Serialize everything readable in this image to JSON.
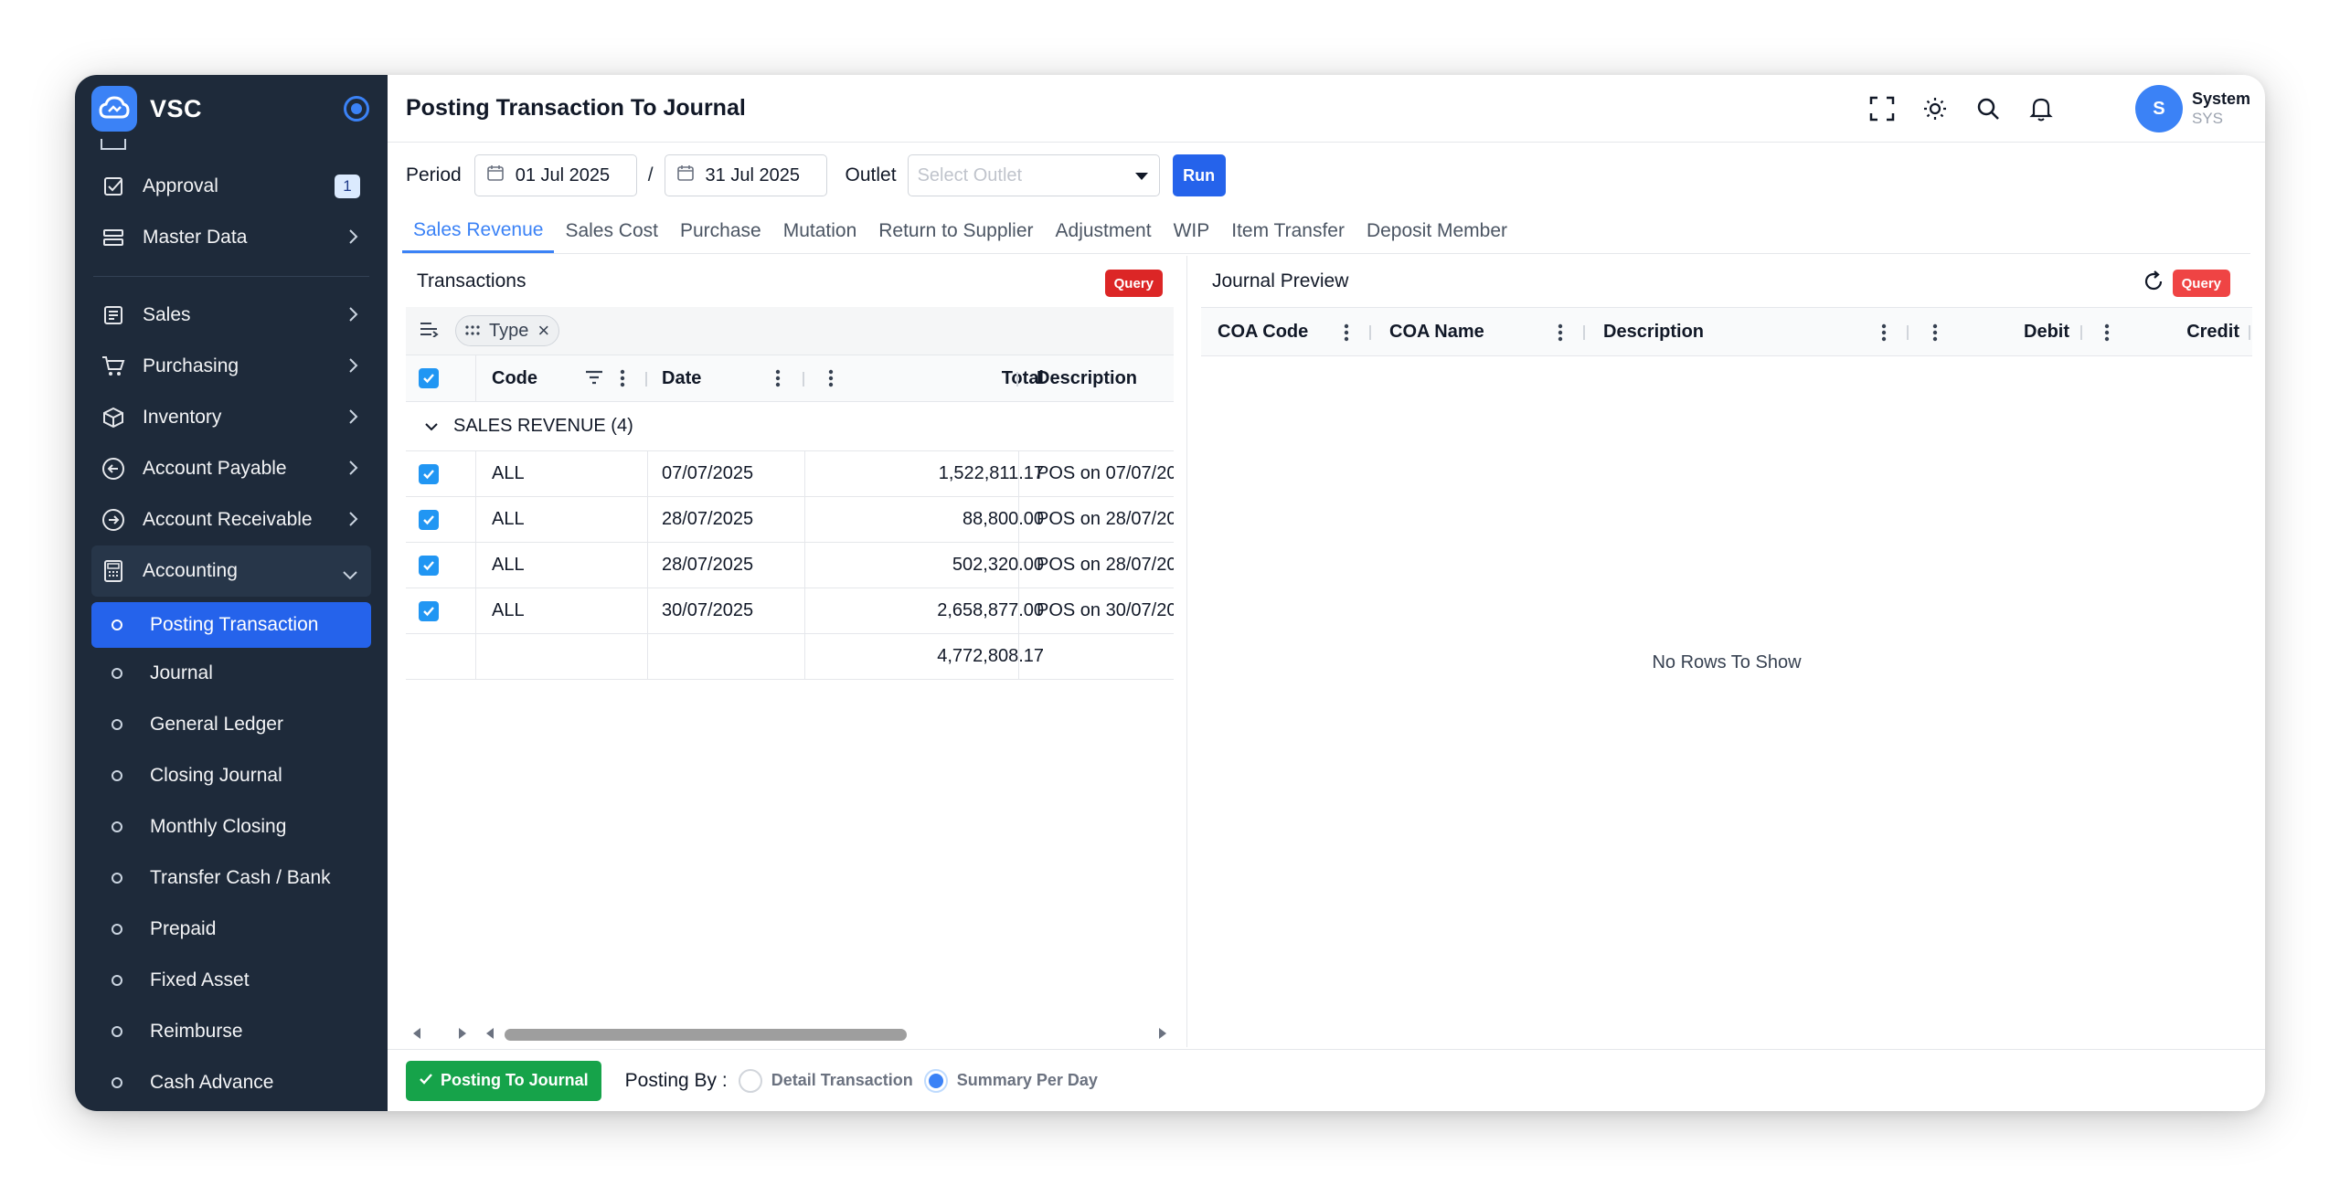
{
  "app": {
    "name": "VSC"
  },
  "sidebar": {
    "items_top": [
      {
        "label": "Approval",
        "badge": "1"
      },
      {
        "label": "Master Data"
      }
    ],
    "items_main": [
      {
        "label": "Sales"
      },
      {
        "label": "Purchasing"
      },
      {
        "label": "Inventory"
      },
      {
        "label": "Account Payable"
      },
      {
        "label": "Account Receivable"
      },
      {
        "label": "Accounting"
      }
    ],
    "submenu": [
      {
        "label": "Posting Transaction"
      },
      {
        "label": "Journal"
      },
      {
        "label": "General Ledger"
      },
      {
        "label": "Closing Journal"
      },
      {
        "label": "Monthly Closing"
      },
      {
        "label": "Transfer Cash / Bank"
      },
      {
        "label": "Prepaid"
      },
      {
        "label": "Fixed Asset"
      },
      {
        "label": "Reimburse"
      },
      {
        "label": "Cash Advance"
      }
    ]
  },
  "header": {
    "title": "Posting Transaction To Journal",
    "user": {
      "initial": "S",
      "name": "System",
      "role": "SYS"
    }
  },
  "filters": {
    "period_label": "Period",
    "date_from": "01 Jul 2025",
    "separator": "/",
    "date_to": "31 Jul 2025",
    "outlet_label": "Outlet",
    "outlet_placeholder": "Select Outlet",
    "run_label": "Run"
  },
  "tabs": [
    {
      "label": "Sales Revenue",
      "active": true
    },
    {
      "label": "Sales Cost"
    },
    {
      "label": "Purchase"
    },
    {
      "label": "Mutation"
    },
    {
      "label": "Return to Supplier"
    },
    {
      "label": "Adjustment"
    },
    {
      "label": "WIP"
    },
    {
      "label": "Item Transfer"
    },
    {
      "label": "Deposit Member"
    }
  ],
  "transactions": {
    "title": "Transactions",
    "query_label": "Query",
    "group_chip": "Type",
    "columns": {
      "code": "Code",
      "date": "Date",
      "total": "Total",
      "description": "Description"
    },
    "group_label": "SALES REVENUE (4)",
    "rows": [
      {
        "code": "ALL",
        "date": "07/07/2025",
        "total": "1,522,811.17",
        "description": "POS on 07/07/20"
      },
      {
        "code": "ALL",
        "date": "28/07/2025",
        "total": "88,800.00",
        "description": "POS on 28/07/20"
      },
      {
        "code": "ALL",
        "date": "28/07/2025",
        "total": "502,320.00",
        "description": "POS on 28/07/20"
      },
      {
        "code": "ALL",
        "date": "30/07/2025",
        "total": "2,658,877.00",
        "description": "POS on 30/07/20"
      }
    ],
    "grand_total": "4,772,808.17"
  },
  "journal": {
    "title": "Journal Preview",
    "query_label": "Query",
    "columns": {
      "coa_code": "COA Code",
      "coa_name": "COA Name",
      "description": "Description",
      "debit": "Debit",
      "credit": "Credit"
    },
    "empty_text": "No Rows To Show"
  },
  "footer": {
    "post_label": "Posting To Journal",
    "posting_by_label": "Posting By :",
    "option_detail": "Detail Transaction",
    "option_summary": "Summary Per Day",
    "selected": "Summary Per Day"
  },
  "colors": {
    "accent": "#2563eb",
    "sidebar_bg": "#1e2a3a",
    "query_red": "#dc2626",
    "post_green": "#16a34a"
  }
}
